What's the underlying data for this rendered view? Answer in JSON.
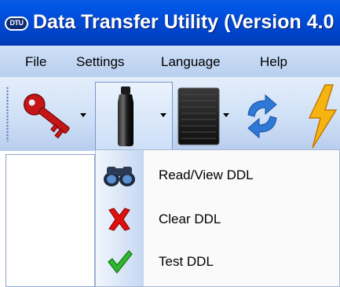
{
  "window": {
    "title": "Data Transfer Utility (Version 4.0",
    "app_icon_text": "DTU"
  },
  "menubar": {
    "items": [
      {
        "label": "File"
      },
      {
        "label": "Settings"
      },
      {
        "label": "Language"
      },
      {
        "label": "Help"
      }
    ]
  },
  "toolbar": {
    "tools": [
      {
        "icon": "key-icon",
        "has_dropdown": true
      },
      {
        "icon": "usb-drive-icon",
        "has_dropdown": true,
        "pressed": true
      },
      {
        "icon": "card-reader-icon",
        "has_dropdown": true
      },
      {
        "icon": "refresh-icon",
        "has_dropdown": false
      },
      {
        "icon": "lightning-icon",
        "has_dropdown": false
      }
    ]
  },
  "dropdown_menu": {
    "items": [
      {
        "label": "Read/View DDL",
        "icon": "binoculars-icon"
      },
      {
        "label": "Clear DDL",
        "icon": "red-x-icon"
      },
      {
        "label": "Test DDL",
        "icon": "green-check-icon"
      }
    ]
  },
  "colors": {
    "titlebar": "#0049d4",
    "menubar": "#c4d7f3",
    "toolbar": "#cfe0f6",
    "x_red": "#e01010",
    "check_green": "#2fb82f"
  }
}
